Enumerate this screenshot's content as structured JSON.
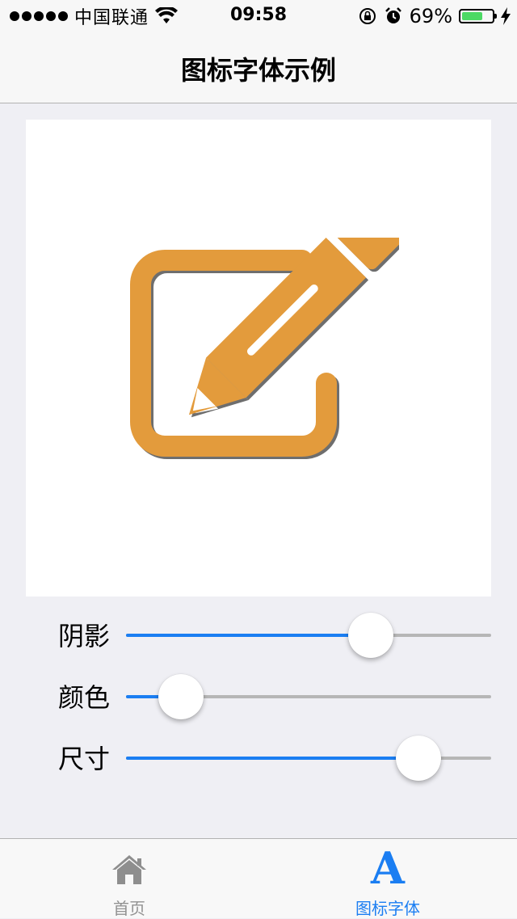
{
  "status_bar": {
    "carrier": "中国联通",
    "time": "09:58",
    "battery_percent": "69%",
    "battery_level": 0.69,
    "icons": [
      "signal-dots",
      "wifi-icon",
      "orientation-lock-icon",
      "alarm-icon",
      "battery-icon",
      "charging-bolt-icon"
    ]
  },
  "nav": {
    "title": "图标字体示例"
  },
  "preview": {
    "icon": "edit-pencil-icon",
    "icon_color": "#e39b3c",
    "shadow_color": "#6e6e6e"
  },
  "sliders": [
    {
      "label": "阴影",
      "value": 0.67
    },
    {
      "label": "颜色",
      "value": 0.15
    },
    {
      "label": "尺寸",
      "value": 0.8
    }
  ],
  "accent_color": "#1b7ef2",
  "tabs": [
    {
      "label": "首页",
      "icon": "home-icon",
      "selected": false
    },
    {
      "label": "图标字体",
      "icon": "font-a-icon",
      "glyph": "A",
      "selected": true
    }
  ]
}
